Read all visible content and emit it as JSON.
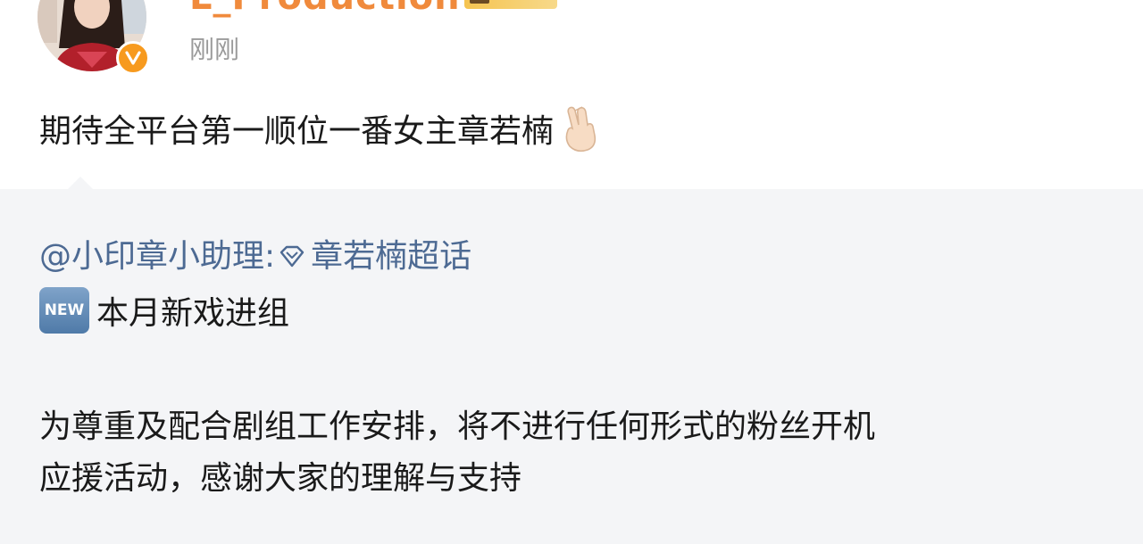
{
  "header": {
    "username": "L_Production",
    "timestamp": "刚刚"
  },
  "post": {
    "text": "期待全平台第一顺位一番女主章若楠",
    "emoji_icon": "crossed-fingers-hand-icon"
  },
  "repost": {
    "author": "@小印章小助理:",
    "topic_icon": "super-topic-diamond-icon",
    "topic": "章若楠超话",
    "new_badge": "NEW",
    "headline": "本月新戏进组",
    "body_lines": [
      "为尊重及配合剧组工作安排，将不进行任何形式的粉丝开机",
      "应援活动，感谢大家的理解与支持"
    ]
  },
  "colors": {
    "link": "#4d6a93",
    "verified": "#f79a1e",
    "username": "#f08a3c",
    "card_bg": "#f4f5f7",
    "timestamp": "#9a9a9a"
  }
}
